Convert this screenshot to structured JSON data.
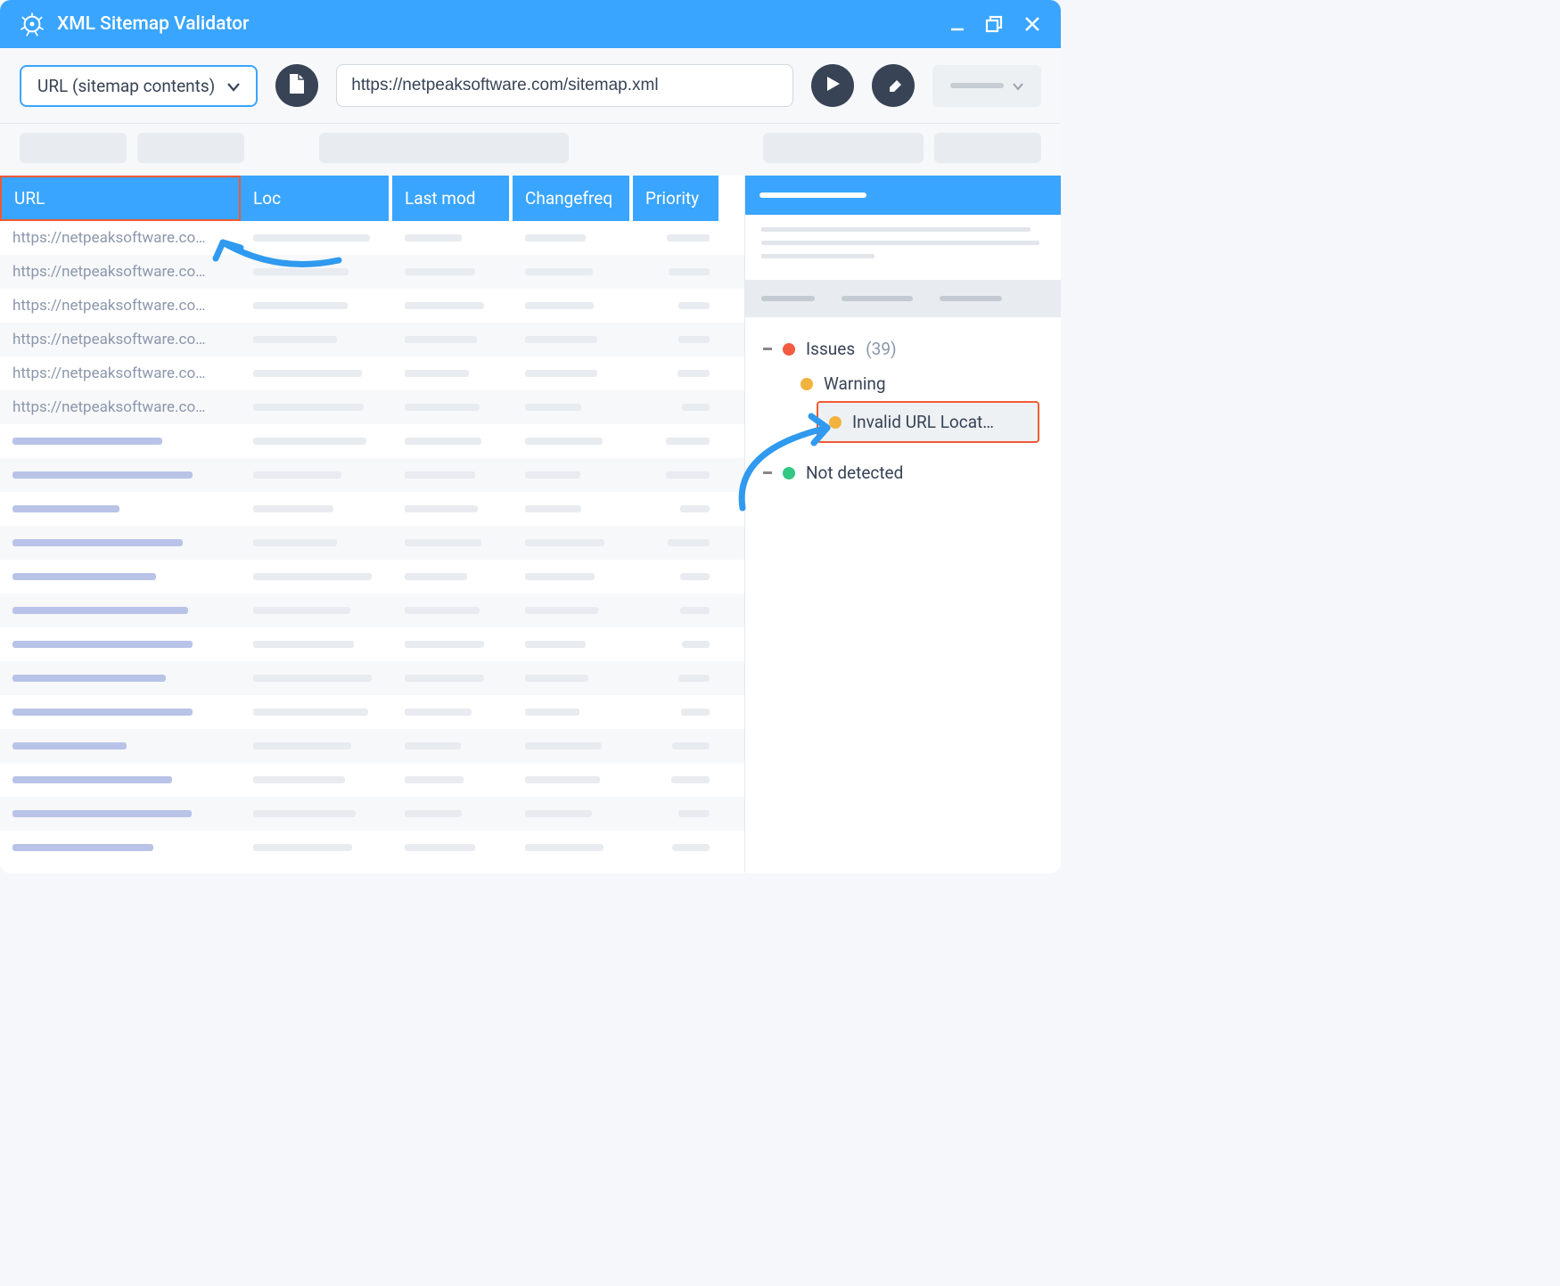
{
  "titlebar": {
    "app_name": "XML Sitemap Validator"
  },
  "toolbar": {
    "mode_label": "URL (sitemap contents)",
    "url_value": "https://netpeaksoftware.com/sitemap.xml"
  },
  "table": {
    "columns": {
      "url": "URL",
      "loc": "Loc",
      "lastmod": "Last mod",
      "changefreq": "Changefreq",
      "priority": "Priority"
    },
    "rows": [
      {
        "url": "https://netpeaksoftware.co…"
      },
      {
        "url": "https://netpeaksoftware.co…"
      },
      {
        "url": "https://netpeaksoftware.co…"
      },
      {
        "url": "https://netpeaksoftware.co…"
      },
      {
        "url": "https://netpeaksoftware.co…"
      },
      {
        "url": "https://netpeaksoftware.co…"
      },
      {
        "url": ""
      },
      {
        "url": ""
      },
      {
        "url": ""
      },
      {
        "url": ""
      },
      {
        "url": ""
      },
      {
        "url": ""
      },
      {
        "url": ""
      },
      {
        "url": ""
      },
      {
        "url": ""
      },
      {
        "url": ""
      },
      {
        "url": ""
      },
      {
        "url": ""
      },
      {
        "url": ""
      }
    ]
  },
  "issues_panel": {
    "issues_label": "Issues",
    "issues_count": "(39)",
    "warning_label": "Warning",
    "invalid_url_label": "Invalid URL Locat…",
    "not_detected_label": "Not detected"
  },
  "colors": {
    "primary": "#39a5ff",
    "highlight_border": "#f05a33",
    "error_dot": "#f25b40",
    "warning_dot": "#f2b23e",
    "ok_dot": "#32c884"
  }
}
